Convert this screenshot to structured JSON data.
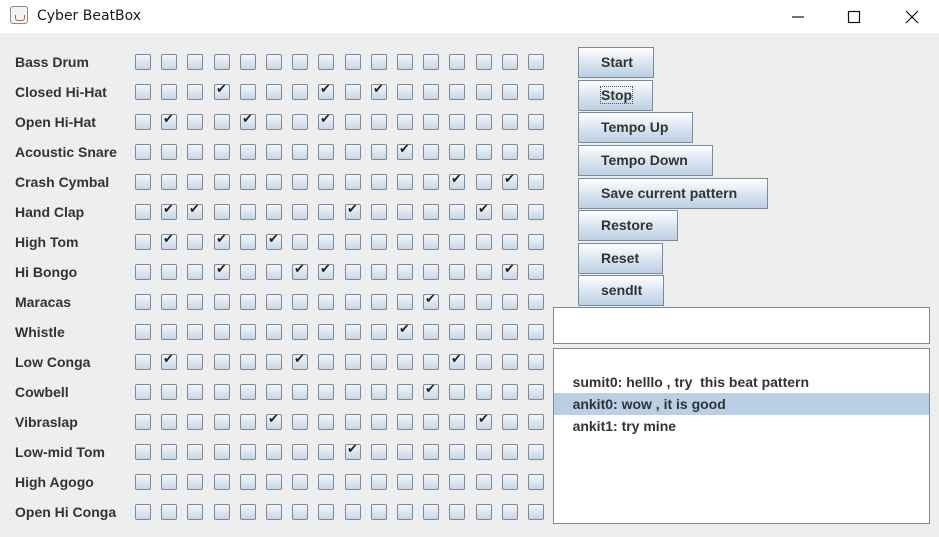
{
  "window": {
    "title": "Cyber BeatBox"
  },
  "instruments": [
    {
      "name": "Bass Drum",
      "beats": [
        0,
        0,
        0,
        0,
        0,
        0,
        0,
        0,
        0,
        0,
        0,
        0,
        0,
        0,
        0,
        0
      ]
    },
    {
      "name": "Closed Hi-Hat",
      "beats": [
        0,
        0,
        0,
        1,
        0,
        0,
        0,
        1,
        0,
        1,
        0,
        0,
        0,
        0,
        0,
        0
      ]
    },
    {
      "name": "Open Hi-Hat",
      "beats": [
        0,
        1,
        0,
        0,
        1,
        0,
        0,
        1,
        0,
        0,
        0,
        0,
        0,
        0,
        0,
        0
      ]
    },
    {
      "name": "Acoustic Snare",
      "beats": [
        0,
        0,
        0,
        0,
        0,
        0,
        0,
        0,
        0,
        0,
        1,
        0,
        0,
        0,
        0,
        0
      ]
    },
    {
      "name": "Crash Cymbal",
      "beats": [
        0,
        0,
        0,
        0,
        0,
        0,
        0,
        0,
        0,
        0,
        0,
        0,
        1,
        0,
        1,
        0
      ]
    },
    {
      "name": "Hand Clap",
      "beats": [
        0,
        1,
        1,
        0,
        0,
        0,
        0,
        0,
        1,
        0,
        0,
        0,
        0,
        1,
        0,
        0
      ]
    },
    {
      "name": "High Tom",
      "beats": [
        0,
        1,
        0,
        1,
        0,
        1,
        0,
        0,
        0,
        0,
        0,
        0,
        0,
        0,
        0,
        0
      ]
    },
    {
      "name": "Hi Bongo",
      "beats": [
        0,
        0,
        0,
        1,
        0,
        0,
        1,
        1,
        0,
        0,
        0,
        0,
        0,
        0,
        1,
        0
      ]
    },
    {
      "name": "Maracas",
      "beats": [
        0,
        0,
        0,
        0,
        0,
        0,
        0,
        0,
        0,
        0,
        0,
        1,
        0,
        0,
        0,
        0
      ]
    },
    {
      "name": "Whistle",
      "beats": [
        0,
        0,
        0,
        0,
        0,
        0,
        0,
        0,
        0,
        0,
        1,
        0,
        0,
        0,
        0,
        0
      ]
    },
    {
      "name": "Low Conga",
      "beats": [
        0,
        1,
        0,
        0,
        0,
        0,
        1,
        0,
        0,
        0,
        0,
        0,
        1,
        0,
        0,
        0
      ]
    },
    {
      "name": "Cowbell",
      "beats": [
        0,
        0,
        0,
        0,
        0,
        0,
        0,
        0,
        0,
        0,
        0,
        1,
        0,
        0,
        0,
        0
      ]
    },
    {
      "name": "Vibraslap",
      "beats": [
        0,
        0,
        0,
        0,
        0,
        1,
        0,
        0,
        0,
        0,
        0,
        0,
        0,
        1,
        0,
        0
      ]
    },
    {
      "name": "Low-mid Tom",
      "beats": [
        0,
        0,
        0,
        0,
        0,
        0,
        0,
        0,
        1,
        0,
        0,
        0,
        0,
        0,
        0,
        0
      ]
    },
    {
      "name": "High Agogo",
      "beats": [
        0,
        0,
        0,
        0,
        0,
        0,
        0,
        0,
        0,
        0,
        0,
        0,
        0,
        0,
        0,
        0
      ]
    },
    {
      "name": "Open Hi Conga",
      "beats": [
        0,
        0,
        0,
        0,
        0,
        0,
        0,
        0,
        0,
        0,
        0,
        0,
        0,
        0,
        0,
        0
      ]
    }
  ],
  "buttons": {
    "start": "Start",
    "stop": "Stop",
    "tempo_up": "Tempo Up",
    "tempo_down": "Tempo Down",
    "save": "Save current pattern",
    "restore": "Restore",
    "reset": "Reset",
    "send": "sendIt"
  },
  "message_input": {
    "value": ""
  },
  "messages": [
    {
      "text": "sumit0: helllo , try  this beat pattern",
      "selected": false
    },
    {
      "text": "ankit0: wow , it is good",
      "selected": false
    },
    {
      "text": "ankit1: try mine",
      "selected": true
    }
  ]
}
